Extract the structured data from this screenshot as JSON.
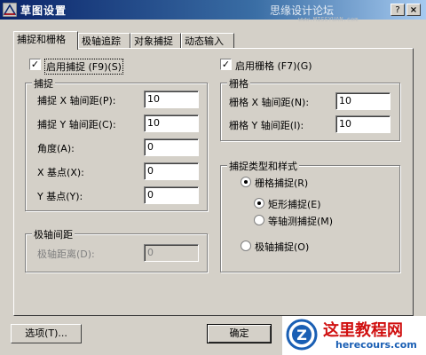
{
  "window": {
    "title": "草图设置",
    "watermark_cn": "思缘设计论坛",
    "watermark_url": "www.MISSYUAN.com"
  },
  "titlebar_buttons": {
    "help": "?",
    "close": "×"
  },
  "tabs": [
    {
      "label": "捕捉和栅格",
      "active": true
    },
    {
      "label": "极轴追踪",
      "active": false
    },
    {
      "label": "对象捕捉",
      "active": false
    },
    {
      "label": "动态输入",
      "active": false
    }
  ],
  "snap_on": {
    "label": "启用捕捉 (F9)(S)",
    "checked": true
  },
  "grid_on": {
    "label": "启用栅格 (F7)(G)",
    "checked": true
  },
  "snap_group": {
    "title": "捕捉",
    "x_spacing_label": "捕捉 X 轴间距(P):",
    "x_spacing": "10",
    "y_spacing_label": "捕捉 Y 轴间距(C):",
    "y_spacing": "10",
    "angle_label": "角度(A):",
    "angle": "0",
    "x_base_label": "X 基点(X):",
    "x_base": "0",
    "y_base_label": "Y 基点(Y):",
    "y_base": "0"
  },
  "polar_group": {
    "title": "极轴间距",
    "distance_label": "极轴距离(D):",
    "distance": "0"
  },
  "grid_group": {
    "title": "栅格",
    "x_spacing_label": "栅格 X 轴间距(N):",
    "x_spacing": "10",
    "y_spacing_label": "栅格 Y 轴间距(I):",
    "y_spacing": "10"
  },
  "snap_type_group": {
    "title": "捕捉类型和样式",
    "grid_snap": "栅格捕捉(R)",
    "rect_snap": "矩形捕捉(E)",
    "iso_snap": "等轴测捕捉(M)",
    "polar_snap": "极轴捕捉(O)"
  },
  "buttons": {
    "options": "选项(T)...",
    "ok": "确定"
  },
  "logo": {
    "name": "这里教程网",
    "url": "herecours.com",
    "mark": "Z"
  },
  "colors": {
    "title_start": "#0a246a",
    "title_end": "#a6caf0",
    "face": "#d4d0c8",
    "logo_red": "#d01010",
    "logo_blue": "#1a5fb4"
  }
}
